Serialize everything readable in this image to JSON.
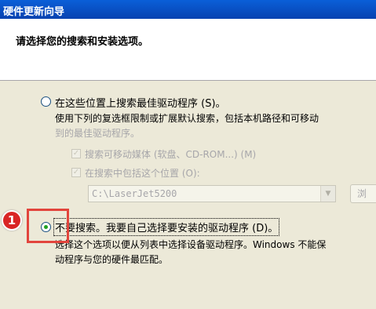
{
  "window": {
    "title": "硬件更新向导"
  },
  "header": {
    "instruction": "请选择您的搜索和安装选项。"
  },
  "option_search": {
    "label": "在这些位置上搜索最佳驱动程序 (S)。",
    "desc_line1": "使用下列的复选框限制或扩展默认搜索，包括本机路径和可移动",
    "desc_line2": "到的最佳驱动程序。",
    "checkbox_removable": "搜索可移动媒体 (软盘、CD-ROM...) (M)",
    "checkbox_location": "在搜索中包括这个位置 (O):",
    "location_value": "C:\\LaserJet5200",
    "browse_label": "浏"
  },
  "option_manual": {
    "label": "不要搜索。我要自己选择要安装的驱动程序 (D)。",
    "desc_line1": "选择这个选项以便从列表中选择设备驱动程序。Windows 不能保",
    "desc_line2": "动程序与您的硬件最匹配。"
  },
  "annotation": {
    "number": "1"
  },
  "colors": {
    "titlebar": "#0a5fd8",
    "annotation": "#e2453d",
    "radio_dot": "#21a121"
  }
}
